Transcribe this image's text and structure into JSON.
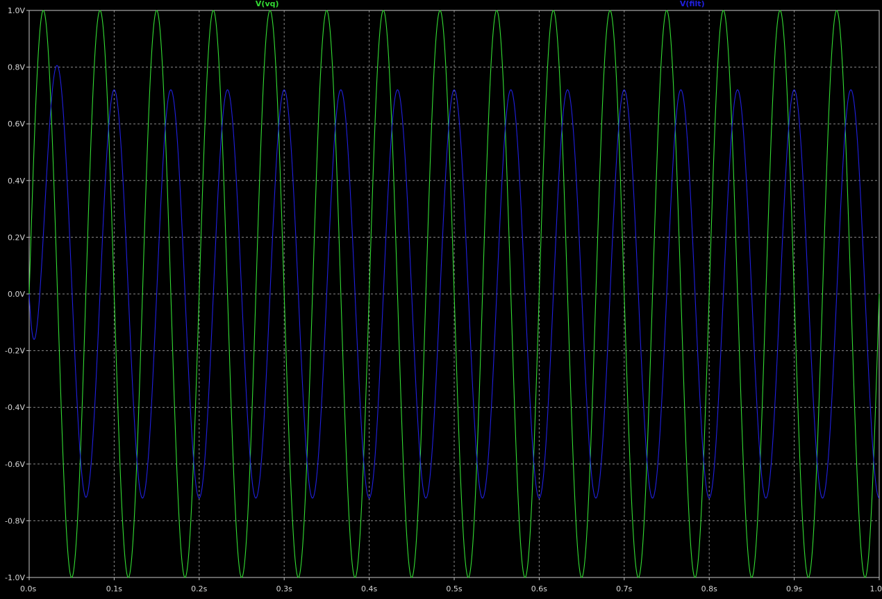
{
  "chart_data": {
    "type": "line",
    "xlim": [
      0.0,
      1.0
    ],
    "ylim": [
      -1.0,
      1.0
    ],
    "x_ticks": [
      {
        "value": 0.0,
        "label": "0.0s"
      },
      {
        "value": 0.1,
        "label": "0.1s"
      },
      {
        "value": 0.2,
        "label": "0.2s"
      },
      {
        "value": 0.3,
        "label": "0.3s"
      },
      {
        "value": 0.4,
        "label": "0.4s"
      },
      {
        "value": 0.5,
        "label": "0.5s"
      },
      {
        "value": 0.6,
        "label": "0.6s"
      },
      {
        "value": 0.7,
        "label": "0.7s"
      },
      {
        "value": 0.8,
        "label": "0.8s"
      },
      {
        "value": 0.9,
        "label": "0.9s"
      },
      {
        "value": 1.0,
        "label": "1.0"
      }
    ],
    "y_ticks": [
      {
        "value": 1.0,
        "label": "1.0V"
      },
      {
        "value": 0.8,
        "label": "0.8V"
      },
      {
        "value": 0.6,
        "label": "0.6V"
      },
      {
        "value": 0.4,
        "label": "0.4V"
      },
      {
        "value": 0.2,
        "label": "0.2V"
      },
      {
        "value": 0.0,
        "label": "0.0V"
      },
      {
        "value": -0.2,
        "label": "-0.2V"
      },
      {
        "value": -0.4,
        "label": "-0.4V"
      },
      {
        "value": -0.6,
        "label": "-0.6V"
      },
      {
        "value": -0.8,
        "label": "-0.8V"
      },
      {
        "value": -1.0,
        "label": "-1.0V"
      }
    ],
    "grid": true,
    "series": [
      {
        "name": "V(vq)",
        "color": "#33dd33",
        "function": "sine",
        "amplitude": 1.0,
        "frequency_hz": 15.0,
        "phase_deg": 0,
        "legend_anchor_x": 0.28
      },
      {
        "name": "V(filt)",
        "color": "#2020e0",
        "function": "sine",
        "amplitude": 0.72,
        "first_peak": 0.76,
        "frequency_hz": 15.0,
        "phase_deg": -90,
        "legend_anchor_x": 0.78
      }
    ],
    "background": "#000000",
    "grid_color": "#8a8a8a"
  }
}
